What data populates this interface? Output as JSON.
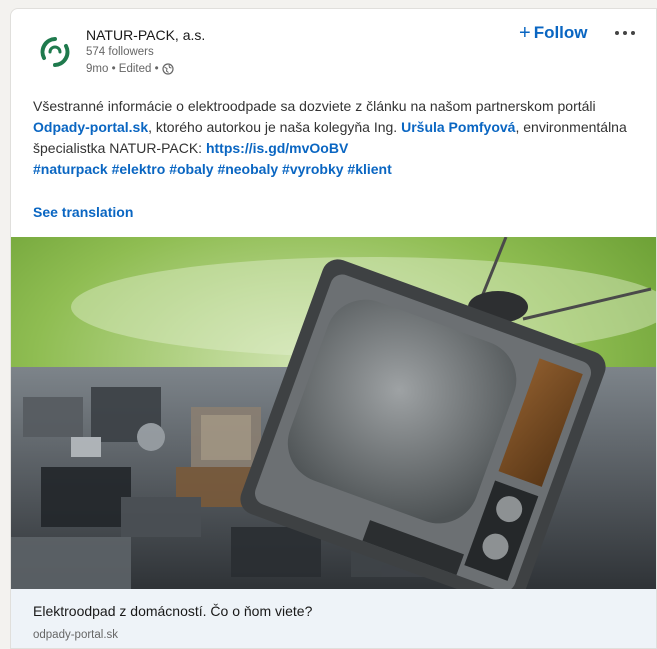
{
  "post": {
    "company_name": "NATUR-PACK, a.s.",
    "followers": "574 followers",
    "meta": "9mo • Edited •",
    "follow_plus": "+",
    "follow_label": "Follow",
    "body": {
      "t1": "Všestranné informácie o elektroodpade sa dozviete z článku na našom partnerskom portáli ",
      "link1": "Odpady-portal.sk",
      "t2": ", ktorého autorkou je naša kolegyňa Ing. ",
      "link2": "Uršula Pomfyová",
      "t3": ", environmentálna špecialistka NATUR-PACK: ",
      "link3": "https://is.gd/mvOoBV",
      "hashtags": [
        "#naturpack",
        "#elektro",
        "#obaly",
        "#neobaly",
        "#vyrobky",
        "#klient"
      ]
    },
    "see_translation": "See translation"
  },
  "link_preview": {
    "title": "Elektroodpad z domácností. Čo o ňom viete?",
    "domain": "odpady-portal.sk"
  },
  "colors": {
    "link": "#0a66c2",
    "logo_green": "#1f7a4d",
    "banner_green": "#7cac3c"
  }
}
